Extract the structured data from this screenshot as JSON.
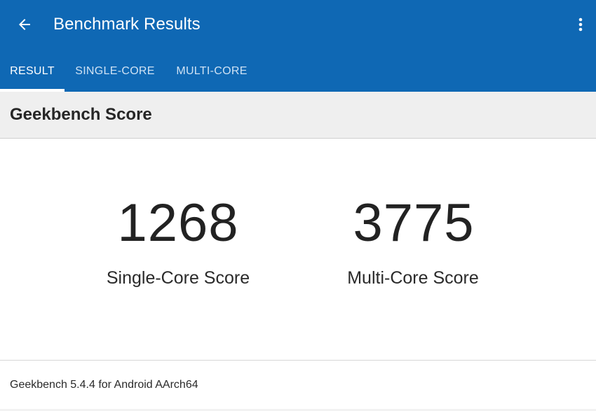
{
  "appbar": {
    "title": "Benchmark Results",
    "back_icon": "arrow-left-icon",
    "menu_icon": "more-vert-icon",
    "color": "#0f68b4"
  },
  "tabs": [
    {
      "label": "RESULT",
      "active": true
    },
    {
      "label": "SINGLE-CORE",
      "active": false
    },
    {
      "label": "MULTI-CORE",
      "active": false
    }
  ],
  "section": {
    "title": "Geekbench Score"
  },
  "scores": {
    "single": {
      "value": "1268",
      "label": "Single-Core Score"
    },
    "multi": {
      "value": "3775",
      "label": "Multi-Core Score"
    }
  },
  "footer": {
    "text": "Geekbench 5.4.4 for Android AArch64"
  }
}
